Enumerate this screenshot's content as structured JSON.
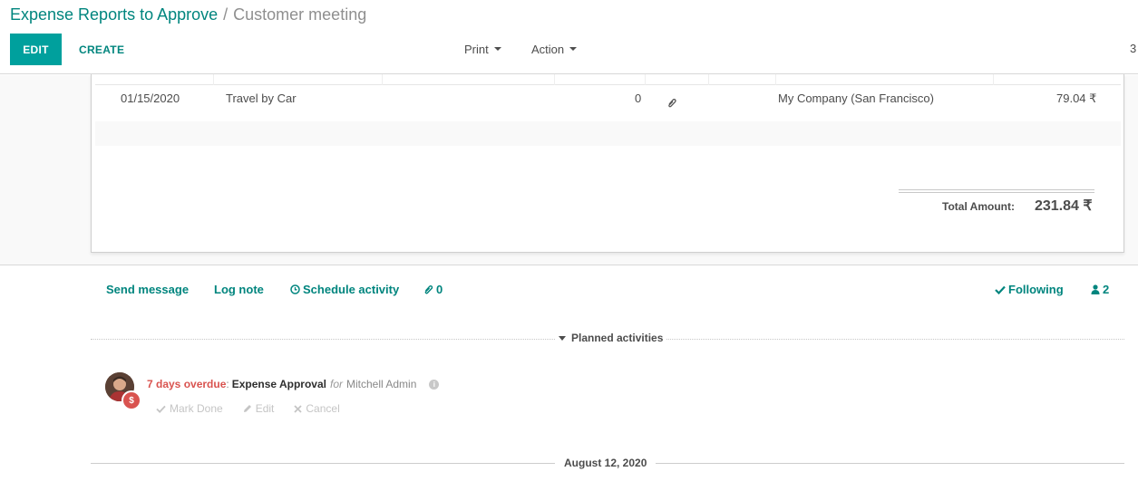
{
  "breadcrumb": {
    "parent": "Expense Reports to Approve",
    "separator": "/",
    "current": "Customer meeting"
  },
  "toolbar": {
    "edit_label": "EDIT",
    "create_label": "CREATE",
    "print_label": "Print",
    "action_label": "Action",
    "pager": "3"
  },
  "expense_line": {
    "date": "01/15/2020",
    "description": "Travel by Car",
    "attachments": "0",
    "company": "My Company (San Francisco)",
    "amount": "79.04 ₹"
  },
  "totals": {
    "label": "Total Amount:",
    "value": "231.84 ₹"
  },
  "chatter": {
    "send_message": "Send message",
    "log_note": "Log note",
    "schedule_activity": "Schedule activity",
    "attachments_count": "0",
    "following": "Following",
    "followers_count": "2"
  },
  "planned": {
    "header": "Planned activities",
    "overdue": "7 days overdue",
    "separator": ":",
    "type": "Expense Approval",
    "for": "for",
    "user": "Mitchell Admin",
    "badge": "$",
    "mark_done": "Mark Done",
    "edit": "Edit",
    "cancel": "Cancel"
  },
  "date_separator": "August 12, 2020",
  "colors": {
    "accent": "#00a09d",
    "link": "#00857e",
    "overdue": "#d9534f"
  }
}
